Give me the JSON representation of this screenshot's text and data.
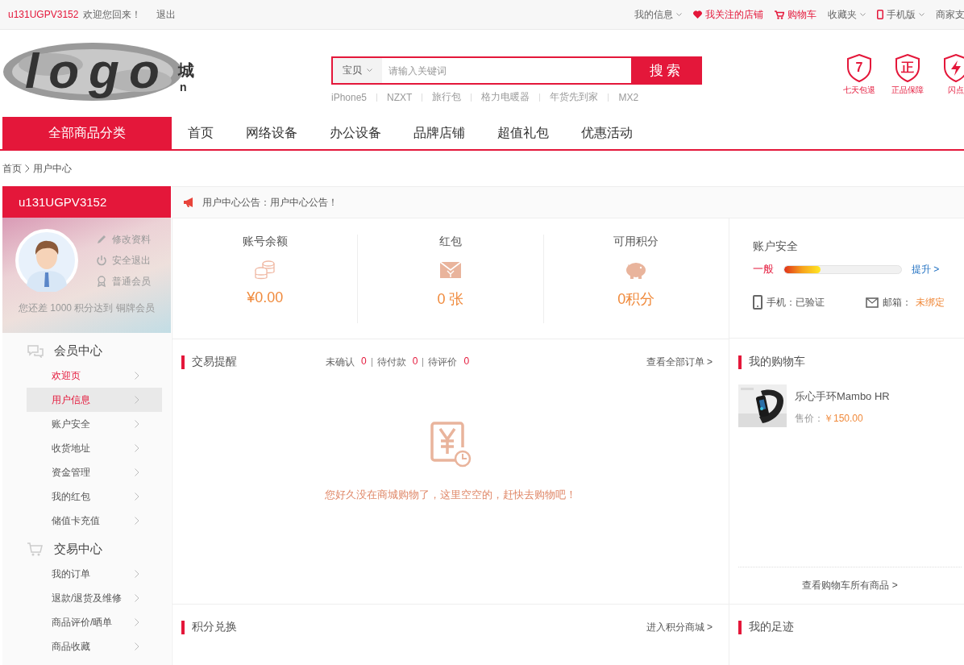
{
  "topbar": {
    "user": "u131UGPV3152",
    "welcome": "欢迎您回来！",
    "logout": "退出",
    "links": [
      {
        "label": "我的信息",
        "kind": "plain",
        "dropdown": true,
        "highlight": false
      },
      {
        "label": "我关注的店铺",
        "kind": "heart",
        "dropdown": false,
        "highlight": true
      },
      {
        "label": "购物车",
        "kind": "cart",
        "dropdown": false,
        "highlight": true
      },
      {
        "label": "收藏夹",
        "kind": "plain",
        "dropdown": true,
        "highlight": false
      },
      {
        "label": "手机版",
        "kind": "phone",
        "dropdown": true,
        "highlight": false
      },
      {
        "label": "商家支",
        "kind": "plain",
        "dropdown": false,
        "highlight": false
      }
    ]
  },
  "logo": {
    "text": "logo",
    "tail": "城",
    "sub": "n"
  },
  "search": {
    "scope": "宝贝",
    "placeholder": "请输入关键词",
    "button": "搜索",
    "hot_words": [
      "iPhone5",
      "NZXT",
      "旅行包",
      "格力电暖器",
      "年货先到家",
      "MX2"
    ]
  },
  "services": [
    {
      "kind": "text",
      "mark": "7",
      "label": "七天包退"
    },
    {
      "kind": "text",
      "mark": "正",
      "label": "正品保障"
    },
    {
      "kind": "bolt",
      "label": "闪点"
    }
  ],
  "nav": {
    "category": "全部商品分类",
    "items": [
      {
        "label": "首页",
        "selected": false
      },
      {
        "label": "网络设备",
        "selected": false
      },
      {
        "label": "办公设备",
        "selected": false
      },
      {
        "label": "品牌店铺",
        "selected": false
      },
      {
        "label": "超值礼包",
        "selected": false
      },
      {
        "label": "优惠活动",
        "selected": false
      }
    ]
  },
  "breadcrumb": [
    "首页",
    "用户中心"
  ],
  "profile": {
    "username": "u131UGPV3152",
    "actions": [
      {
        "kind": "pencil",
        "label": "修改资料"
      },
      {
        "kind": "power",
        "label": "安全退出"
      },
      {
        "kind": "ribbon",
        "label": "普通会员"
      }
    ],
    "upgrade_note": "您还差 1000 积分达到 铜牌会员"
  },
  "menu": [
    {
      "title": "会员中心",
      "kind": "chat",
      "items": [
        {
          "label": "欢迎页",
          "highlighted": true,
          "selected": false
        },
        {
          "label": "用户信息",
          "highlighted": true,
          "selected": true
        },
        {
          "label": "账户安全",
          "highlighted": false,
          "selected": false
        },
        {
          "label": "收货地址",
          "highlighted": false,
          "selected": false
        },
        {
          "label": "资金管理",
          "highlighted": false,
          "selected": false
        },
        {
          "label": "我的红包",
          "highlighted": false,
          "selected": false
        },
        {
          "label": "储值卡充值",
          "highlighted": false,
          "selected": false
        }
      ]
    },
    {
      "title": "交易中心",
      "kind": "cart",
      "items": [
        {
          "label": "我的订单",
          "highlighted": false,
          "selected": false
        },
        {
          "label": "退款/退货及维修",
          "highlighted": false,
          "selected": false
        },
        {
          "label": "商品评价/晒单",
          "highlighted": false,
          "selected": false
        },
        {
          "label": "商品收藏",
          "highlighted": false,
          "selected": false
        }
      ]
    }
  ],
  "notice": "用户中心公告：用户中心公告！",
  "stats": [
    {
      "label": "账号余额",
      "kind": "coins",
      "value": "¥0.00"
    },
    {
      "label": "红包",
      "kind": "envelope",
      "value": "0 张"
    },
    {
      "label": "可用积分",
      "kind": "piggy",
      "value": "0积分"
    }
  ],
  "security": {
    "title": "账户安全",
    "level_label": "一般",
    "level": 0.31,
    "upgrade": "提升 >",
    "phone_label": "手机：已验证",
    "email_label": "邮箱：",
    "email_status": "未绑定"
  },
  "trade": {
    "title": "交易提醒",
    "counters": [
      {
        "label": "未确认",
        "count": "0"
      },
      {
        "label": "待付款",
        "count": "0"
      },
      {
        "label": "待评价",
        "count": "0"
      }
    ],
    "more": "查看全部订单 >",
    "empty_message": "您好久没在商城购物了，这里空空的，赶快去购物吧！"
  },
  "cart": {
    "title": "我的购物车",
    "items": [
      {
        "kind": "picture",
        "name": "乐心手环Mambo HR",
        "price_label": "售价：",
        "price": "￥150.00"
      }
    ],
    "more": "查看购物车所有商品 >"
  },
  "points": {
    "title": "积分兑换",
    "more": "进入积分商城 >"
  },
  "footprints": {
    "title": "我的足迹"
  }
}
